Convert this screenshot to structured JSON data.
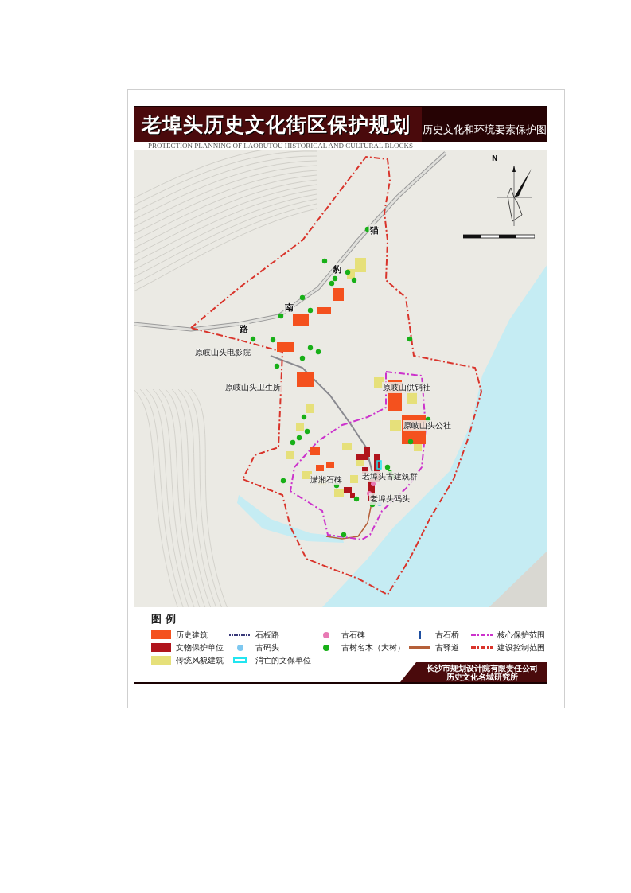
{
  "header": {
    "title": "老埠头历史文化街区保护规划",
    "subtitle": "历史文化和环境要素保护图",
    "english_title": "PROTECTION PLANNING OF LAOBUTOU HISTORICAL AND CULTURAL BLOCKS"
  },
  "map": {
    "north_label": "N",
    "labels": [
      {
        "text": "猫",
        "kind": "road"
      },
      {
        "text": "豹",
        "kind": "road"
      },
      {
        "text": "南",
        "kind": "road"
      },
      {
        "text": "路",
        "kind": "road"
      },
      {
        "text": "原岐山头电影院",
        "kind": "place"
      },
      {
        "text": "原岐山头卫生所",
        "kind": "place"
      },
      {
        "text": "原岐山供销社",
        "kind": "place"
      },
      {
        "text": "原岐山头公社",
        "kind": "place"
      },
      {
        "text": "潇湘石碑",
        "kind": "place"
      },
      {
        "text": "老埠头古建筑群",
        "kind": "place"
      },
      {
        "text": "老埠头码头",
        "kind": "place"
      }
    ]
  },
  "legend": {
    "title": "图 例",
    "items": [
      {
        "label": "历史建筑",
        "kind": "fill",
        "color": "#f4511e"
      },
      {
        "label": "石板路",
        "kind": "dotted",
        "color": "#3a3a7a"
      },
      {
        "label": "古石碑",
        "kind": "dot",
        "color": "#e879b4"
      },
      {
        "label": "古石桥",
        "kind": "bar",
        "color": "#1f4fa0"
      },
      {
        "label": "核心保护范围",
        "kind": "dashdot",
        "color": "#cc33cc"
      },
      {
        "label": "文物保护单位",
        "kind": "fill",
        "color": "#b0141c"
      },
      {
        "label": "古码头",
        "kind": "dot",
        "color": "#7ec8f0"
      },
      {
        "label": "古树名木（大树）",
        "kind": "dot",
        "color": "#18b018"
      },
      {
        "label": "古驿道",
        "kind": "line",
        "color": "#b5603a"
      },
      {
        "label": "建设控制范围",
        "kind": "dashdot",
        "color": "#d9342b"
      },
      {
        "label": "传统风貌建筑",
        "kind": "fill",
        "color": "#e6e07a"
      },
      {
        "label": "消亡的文保单位",
        "kind": "outline",
        "color": "#22e5f0"
      }
    ],
    "credit": [
      "长沙市规划设计院有限责任公司",
      "历史文化名城研究所"
    ]
  }
}
